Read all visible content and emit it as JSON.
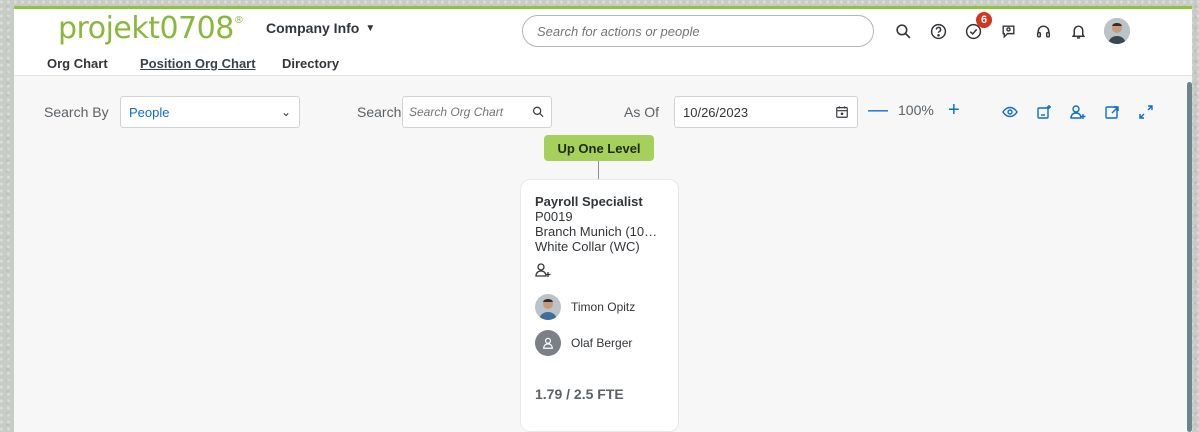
{
  "app": {
    "logo_text": "projekt0708",
    "logo_mark": "®",
    "module_menu": "Company Info",
    "search_placeholder": "Search for actions or people",
    "notification_badge": "6",
    "accent_color": "#8fc43f",
    "link_color": "#0a6ed1"
  },
  "top_icons": [
    "search-icon",
    "help-icon",
    "tasks-icon",
    "chat-icon",
    "headset-icon",
    "bell-icon",
    "user-avatar"
  ],
  "subnav": {
    "tabs": [
      {
        "label": "Org Chart",
        "active": false
      },
      {
        "label": "Position Org Chart",
        "active": true
      },
      {
        "label": "Directory",
        "active": false
      }
    ]
  },
  "toolbar": {
    "search_by_label": "Search By",
    "search_by_value": "People",
    "search_label": "Search",
    "search_placeholder": "Search Org Chart",
    "as_of_label": "As Of",
    "as_of_value": "10/26/2023",
    "zoom_level": "100%",
    "zoom_minus": "—",
    "zoom_plus": "+"
  },
  "chart": {
    "up_one_level": "Up One Level",
    "card": {
      "title": "Payroll Specialist",
      "code": "P0019",
      "location": "Branch Munich (1000...",
      "category": "White Collar (WC)",
      "people": [
        {
          "name": "Timon Opitz",
          "has_photo": true
        },
        {
          "name": "Olaf Berger",
          "has_photo": false
        }
      ],
      "fte": "1.79 / 2.5 FTE"
    }
  }
}
